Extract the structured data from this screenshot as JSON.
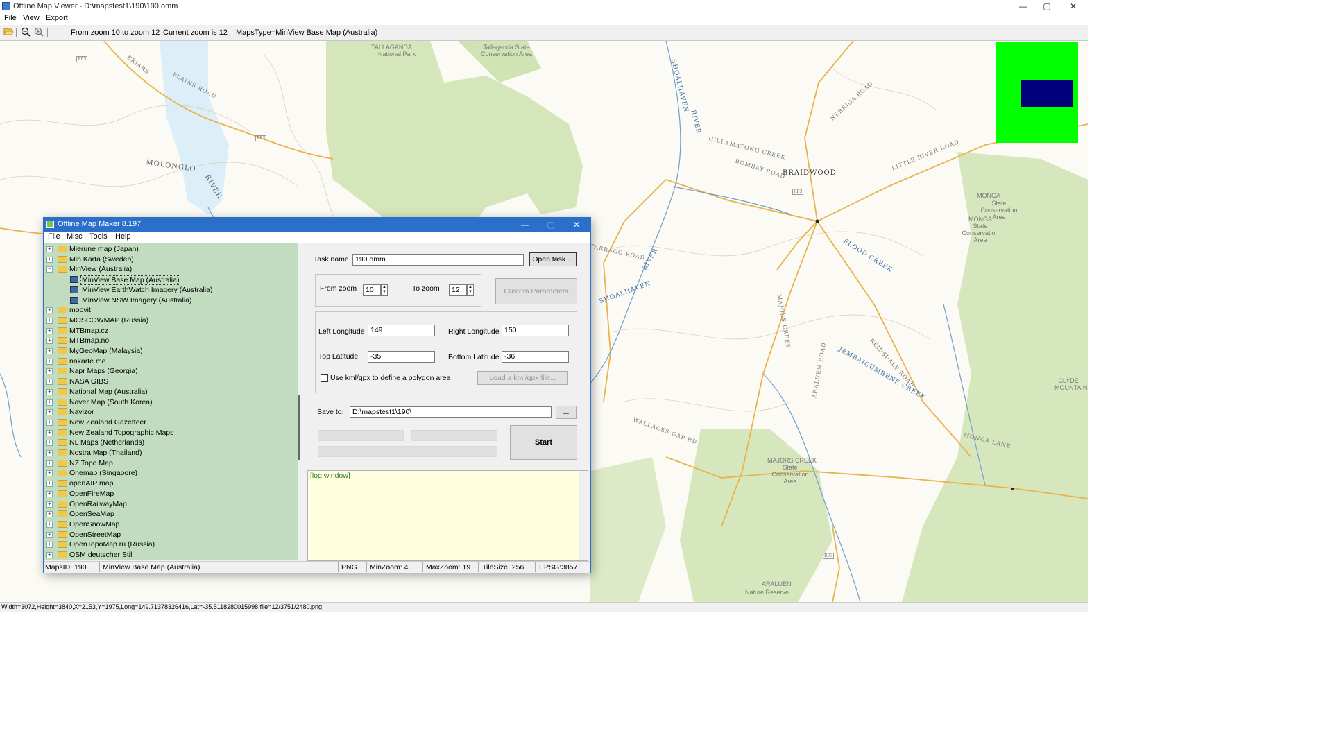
{
  "window": {
    "title": "Offline Map Viewer - D:\\mapstest1\\190\\190.omm",
    "minimize": "—",
    "maximize": "▢",
    "close": "✕"
  },
  "menu": {
    "file": "File",
    "view": "View",
    "export": "Export"
  },
  "toolbar": {
    "open_icon": "folder-open-icon",
    "zoom_out_icon": "zoom-out-icon",
    "zoom_in_icon": "zoom-in-icon",
    "zoom_range": "From zoom 10 to zoom 12",
    "current_zoom": "Current zoom is 12",
    "maps_type": "MapsType=MinView Base Map (Australia)"
  },
  "map": {
    "labels": {
      "tallaganda": "TALLAGANDA",
      "national_park": "National Park",
      "tallaganda_sca": "Tallaganda State Conservation Area",
      "molonglo": "MOLONGLO",
      "river_molonglo": "RIVER",
      "plains_road": "PLAINS ROAD",
      "briars": "BRIARS",
      "shoalhaven": "SHOALHAVEN",
      "river_shoalhaven": "RIVER",
      "braidwood": "BRAIDWOOD",
      "nerriga_road": "NERRIGA ROAD",
      "little_river_road": "LITTLE RIVER ROAD",
      "bombay_road": "BOMBAY ROAD",
      "gillamatong": "GILLAMATONG CREEK",
      "monga": "MONGA",
      "monga_sca": "State Conservation Area",
      "monga2": "MONGA",
      "monga_sca2": "State Conservation Area",
      "tarrago_road": "TARRAGO ROAD",
      "shoalhaven2": "SHOALHAVEN",
      "river2": "RIVER",
      "majors_creek": "MAJORS CREEK",
      "majors_creek_sca": "MAJORS CREEK",
      "majors_creek_sca_sub": "State Conservation Area",
      "reidsdale_road": "REIDSDALE ROAD",
      "araluen_road": "ARALUEN ROAD",
      "wallaces_gap": "WALLACES GAP RD",
      "monga_lane": "MONGA LANE",
      "araluen": "ARALUEN",
      "araluen_nr": "Nature Reserve",
      "clyde_mountain": "CLYDE MOUNTAIN",
      "jembaicumbene": "JEMBAICUMBENE CREEK",
      "flood_creek": "FLOOD CREEK",
      "road_badge_1": "RP3",
      "road_badge_2": "RP3",
      "road_badge_3": "RP3",
      "road_badge_4": "RP3"
    },
    "overview": {
      "colors": {
        "background": "#00ff00",
        "viewport": "#00007a"
      }
    }
  },
  "statusbar": {
    "text": "Width=3072,Height=3840,X=2153,Y=1975,Long=149.71378326416,Lat=-35.5118280015998,file=12/3751/2480.png"
  },
  "dialog": {
    "title": "Offline Map Maker 8.197",
    "minimize": "—",
    "maximize": "▢",
    "close": "✕",
    "menu": {
      "file": "File",
      "misc": "Misc",
      "tools": "Tools",
      "help": "Help"
    },
    "tree": [
      {
        "label": "Mierune map (Japan)",
        "exp": "+"
      },
      {
        "label": "Min Karta (Sweden)",
        "exp": "+"
      },
      {
        "label": "MinView (Australia)",
        "exp": "−"
      },
      {
        "label": "MinView Base Map (Australia)",
        "child": true,
        "selected": true
      },
      {
        "label": "MinView EarthWatch Imagery (Australia)",
        "child": true
      },
      {
        "label": "MinView NSW Imagery (Australia)",
        "child": true
      },
      {
        "label": "moovit",
        "exp": "+"
      },
      {
        "label": "MOSCOWMAP (Russia)",
        "exp": "+"
      },
      {
        "label": "MTBmap.cz",
        "exp": "+"
      },
      {
        "label": "MTBmap.no",
        "exp": "+"
      },
      {
        "label": "MyGeoMap (Malaysia)",
        "exp": "+"
      },
      {
        "label": "nakarte.me",
        "exp": "+"
      },
      {
        "label": "Napr Maps (Georgia)",
        "exp": "+"
      },
      {
        "label": "NASA GIBS",
        "exp": "+"
      },
      {
        "label": "National Map (Australia)",
        "exp": "+"
      },
      {
        "label": "Naver Map (South Korea)",
        "exp": "+"
      },
      {
        "label": "Navizor",
        "exp": "+"
      },
      {
        "label": "New Zealand Gazetteer",
        "exp": "+"
      },
      {
        "label": "New Zealand Topographic Maps",
        "exp": "+"
      },
      {
        "label": "NL Maps (Netherlands)",
        "exp": "+"
      },
      {
        "label": "Nostra Map (Thailand)",
        "exp": "+"
      },
      {
        "label": "NZ Topo Map",
        "exp": "+"
      },
      {
        "label": "Onemap (Singapore)",
        "exp": "+"
      },
      {
        "label": "openAIP map",
        "exp": "+"
      },
      {
        "label": "OpenFireMap",
        "exp": "+"
      },
      {
        "label": "OpenRailwayMap",
        "exp": "+"
      },
      {
        "label": "OpenSeaMap",
        "exp": "+"
      },
      {
        "label": "OpenSnowMap",
        "exp": "+"
      },
      {
        "label": "OpenStreetMap",
        "exp": "+"
      },
      {
        "label": "OpenTopoMap.ru (Russia)",
        "exp": "+"
      },
      {
        "label": "OSM deutscher Stil",
        "exp": "+"
      }
    ],
    "form": {
      "task_name_label": "Task name",
      "task_name_value": "190.omm",
      "open_task": "Open task ...",
      "from_zoom_label": "From zoom",
      "from_zoom_value": "10",
      "to_zoom_label": "To zoom",
      "to_zoom_value": "12",
      "custom_params": "Custom Parameters",
      "left_lon_label": "Left Longitude",
      "left_lon_value": "149",
      "right_lon_label": "Right Longitude",
      "right_lon_value": "150",
      "top_lat_label": "Top Latitude",
      "top_lat_value": "-35",
      "bottom_lat_label": "Bottom Latitude",
      "bottom_lat_value": "-36",
      "kml_checkbox_label": "Use kml/gpx to define a polygon area",
      "load_kml": "Load a kml/gpx file...",
      "save_to_label": "Save to:",
      "save_to_value": "D:\\mapstest1\\190\\",
      "browse": "...",
      "start": "Start",
      "spin_up": "▲",
      "spin_down": "▼"
    },
    "log": {
      "text": "[log window]"
    },
    "status": {
      "maps_id": "MapsID: 190",
      "map_name": "MinView Base Map (Australia)",
      "format": "PNG",
      "min_zoom": "MinZoom: 4",
      "max_zoom": "MaxZoom: 19",
      "tile_size": "TileSize: 256",
      "epsg": "EPSG:3857"
    }
  }
}
